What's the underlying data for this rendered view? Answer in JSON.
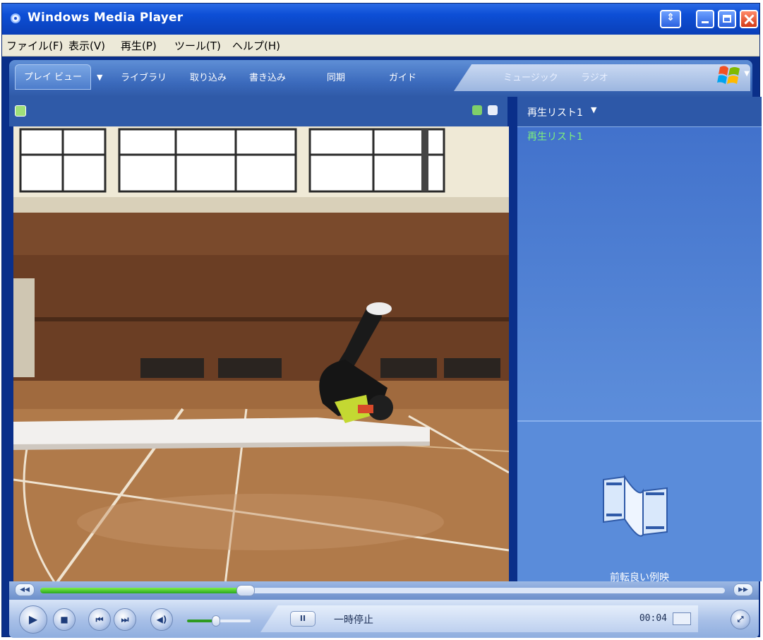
{
  "window": {
    "title": "Windows Media Player"
  },
  "menubar": {
    "items": [
      "ファイル(F)",
      "表示(V)",
      "再生(P)",
      "ツール(T)",
      "ヘルプ(H)"
    ]
  },
  "nav": {
    "tabs": [
      "プレイ ビュー",
      "ライブラリ",
      "取り込み",
      "書き込み",
      "同期",
      "ガイド"
    ],
    "dropdown_glyph": "▼",
    "online_tabs": [
      "ミュージック",
      "ラジオ"
    ]
  },
  "playlist": {
    "title": "再生リスト1",
    "title_arrow": "▼",
    "entries": [
      "再生リスト1"
    ],
    "caption": "前転良い例映"
  },
  "controls": {
    "play_glyph": "▶",
    "stop_glyph": "■",
    "prev_glyph": "⏮",
    "next_glyph": "⏭",
    "mute_glyph": "◀)",
    "pause_glyph": "II",
    "fullscreen_glyph": "⤢",
    "seek_left_glyph": "◀◀",
    "seek_right_glyph": "▶▶"
  },
  "status": {
    "text": "一時停止",
    "time": "00:04"
  },
  "playback": {
    "seek_fraction": 0.3,
    "volume_fraction": 0.45
  },
  "colors": {
    "titlebar": "#0d4fd6",
    "nav": "#3c6bbd",
    "playlist_entry": "#7ef07a",
    "seek_fill": "#2aa820"
  }
}
